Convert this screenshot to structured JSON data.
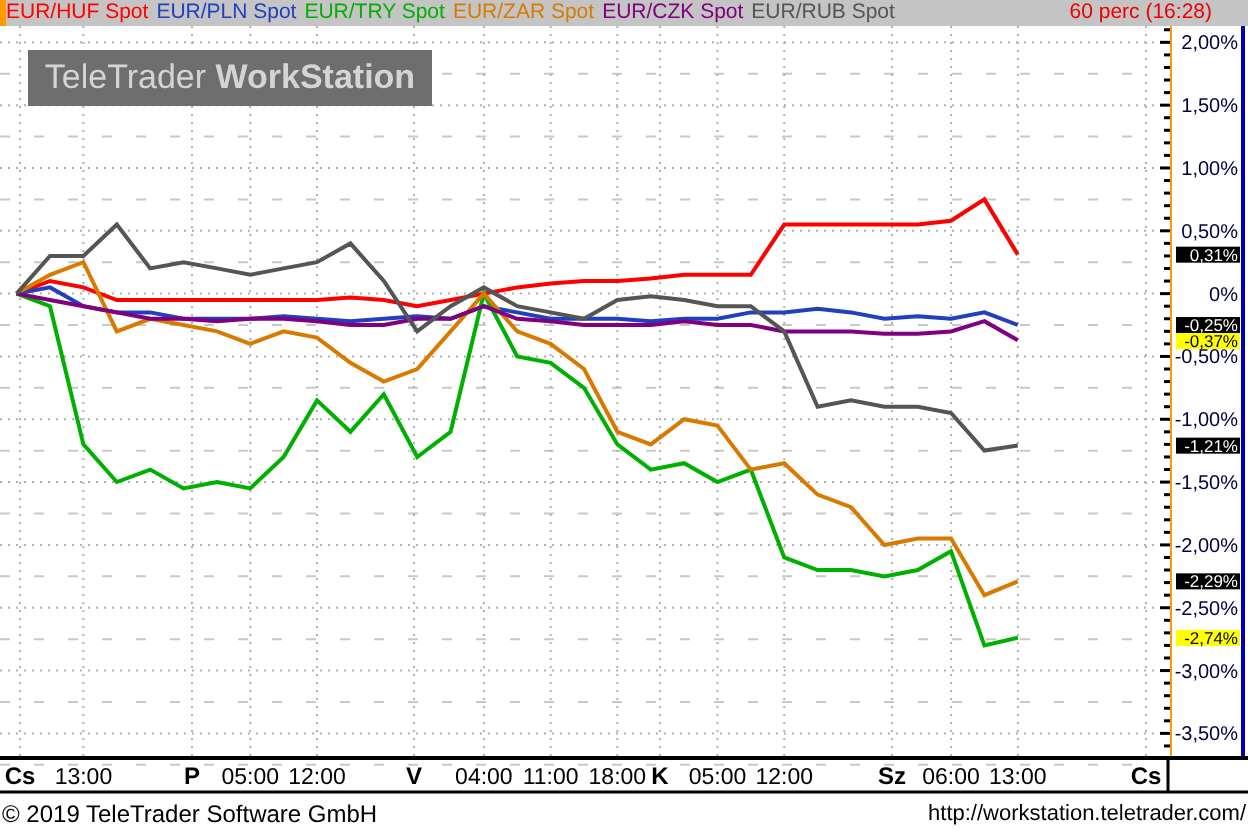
{
  "header": {
    "interval": "60 perc (16:28)"
  },
  "logo": "TeleTrader **WorkStation**",
  "chart_data": {
    "type": "line",
    "grid": true,
    "ylim": [
      -3.68,
      2.13
    ],
    "categories": [
      null,
      null,
      "13:00",
      null,
      null,
      null,
      null,
      "05:00",
      null,
      "12:00",
      null,
      null,
      null,
      null,
      "04:00",
      null,
      "11:00",
      null,
      "18:00",
      null,
      null,
      "05:00",
      null,
      "12:00",
      null,
      null,
      null,
      null,
      "06:00",
      null,
      "13:00"
    ],
    "series": [
      {
        "name": "EUR/HUF Spot",
        "color": "#ff0000",
        "values": [
          0,
          0.1,
          0.05,
          -0.05,
          -0.05,
          -0.05,
          -0.05,
          -0.05,
          -0.05,
          -0.05,
          -0.03,
          -0.05,
          -0.1,
          -0.05,
          0,
          0.05,
          0.08,
          0.1,
          0.1,
          0.12,
          0.15,
          0.15,
          0.15,
          0.55,
          0.55,
          0.55,
          0.55,
          0.55,
          0.58,
          0.75,
          0.31
        ]
      },
      {
        "name": "EUR/PLN Spot",
        "color": "#2040c0",
        "values": [
          0,
          0.05,
          -0.1,
          -0.15,
          -0.15,
          -0.2,
          -0.2,
          -0.2,
          -0.18,
          -0.2,
          -0.22,
          -0.2,
          -0.18,
          -0.2,
          -0.1,
          -0.15,
          -0.2,
          -0.2,
          -0.2,
          -0.22,
          -0.2,
          -0.2,
          -0.15,
          -0.15,
          -0.12,
          -0.15,
          -0.2,
          -0.18,
          -0.2,
          -0.15,
          -0.25
        ]
      },
      {
        "name": "EUR/TRY Spot",
        "color": "#00b000",
        "values": [
          0,
          -0.1,
          -1.2,
          -1.5,
          -1.4,
          -1.55,
          -1.5,
          -1.55,
          -1.3,
          -0.85,
          -1.1,
          -0.8,
          -1.3,
          -1.1,
          0,
          -0.5,
          -0.55,
          -0.75,
          -1.2,
          -1.4,
          -1.35,
          -1.5,
          -1.4,
          -2.1,
          -2.2,
          -2.2,
          -2.25,
          -2.2,
          -2.05,
          -2.8,
          -2.74
        ]
      },
      {
        "name": "EUR/ZAR Spot",
        "color": "#d97a00",
        "values": [
          0,
          0.15,
          0.25,
          -0.3,
          -0.2,
          -0.25,
          -0.3,
          -0.4,
          -0.3,
          -0.35,
          -0.55,
          -0.7,
          -0.6,
          -0.3,
          0,
          -0.3,
          -0.4,
          -0.6,
          -1.1,
          -1.2,
          -1,
          -1.05,
          -1.4,
          -1.35,
          -1.6,
          -1.7,
          -2,
          -1.95,
          -1.95,
          -2.4,
          -2.29
        ]
      },
      {
        "name": "EUR/CZK Spot",
        "color": "#800080",
        "values": [
          0,
          -0.05,
          -0.1,
          -0.15,
          -0.2,
          -0.2,
          -0.22,
          -0.2,
          -0.2,
          -0.22,
          -0.25,
          -0.25,
          -0.2,
          -0.2,
          -0.1,
          -0.2,
          -0.22,
          -0.25,
          -0.25,
          -0.25,
          -0.22,
          -0.25,
          -0.25,
          -0.3,
          -0.3,
          -0.3,
          -0.32,
          -0.32,
          -0.3,
          -0.22,
          -0.37
        ]
      },
      {
        "name": "EUR/RUB Spot",
        "color": "#555555",
        "values": [
          0,
          0.3,
          0.3,
          0.55,
          0.2,
          0.25,
          0.2,
          0.15,
          0.2,
          0.25,
          0.4,
          0.1,
          -0.3,
          -0.1,
          0.05,
          -0.1,
          -0.15,
          -0.2,
          -0.05,
          -0.02,
          -0.05,
          -0.1,
          -0.1,
          -0.3,
          -0.9,
          -0.85,
          -0.9,
          -0.9,
          -0.95,
          -1.25,
          -1.21
        ]
      }
    ],
    "yticks": [
      {
        "value": 2,
        "label": "2,00%"
      },
      {
        "value": 1.5,
        "label": "1,50%"
      },
      {
        "value": 1,
        "label": "1,00%"
      },
      {
        "value": 0.5,
        "label": "0,50%"
      },
      {
        "value": 0,
        "label": "0%"
      },
      {
        "value": -0.5,
        "label": "-0,50%"
      },
      {
        "value": -1,
        "label": "-1,00%"
      },
      {
        "value": -1.5,
        "label": "-1,50%"
      },
      {
        "value": -2,
        "label": "-2,00%"
      },
      {
        "value": -2.5,
        "label": "-2,50%"
      },
      {
        "value": -3,
        "label": "-3,00%"
      },
      {
        "value": -3.5,
        "label": "-3,50%"
      }
    ]
  },
  "value_labels": [
    {
      "text": "0,31%",
      "highlighted": false
    },
    {
      "text": "-0,25%",
      "highlighted": false
    },
    {
      "text": "-0,37%",
      "highlighted": true
    },
    {
      "text": "-1,21%",
      "highlighted": false
    },
    {
      "text": "-2,29%",
      "highlighted": false
    },
    {
      "text": "-2,74%",
      "highlighted": true
    }
  ],
  "day_labels": [
    "Cs",
    "P",
    "V",
    "K",
    "Sz",
    "Cs"
  ],
  "footer": {
    "copyright": "© 2019 TeleTrader Software GmbH",
    "url": "http://workstation.teletrader.com/"
  }
}
